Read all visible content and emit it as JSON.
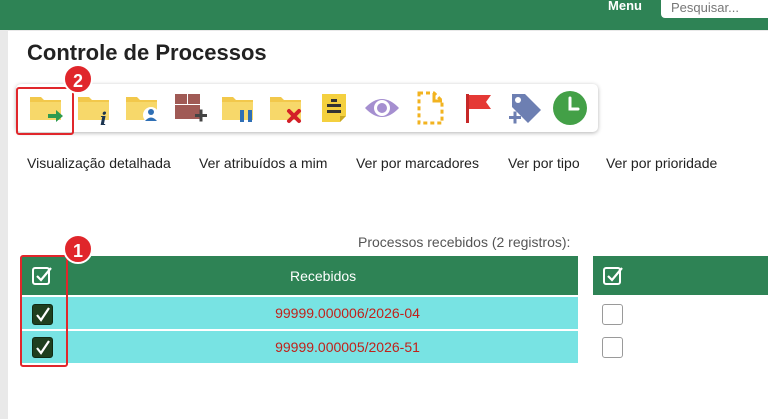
{
  "header": {
    "menu_label": "Menu",
    "search_placeholder": "Pesquisar..."
  },
  "page": {
    "title": "Controle de Processos"
  },
  "toolbar": {
    "icons": [
      "iniciar-processo-icon",
      "retorno-programado-info-icon",
      "atribuir-processo-icon",
      "incluir-em-bloco-icon",
      "sobrestar-processo-icon",
      "concluir-processo-icon",
      "anotacoes-icon",
      "acompanhamento-especial-icon",
      "documento-icon",
      "marcador-icon",
      "adicionar-tipo-icon",
      "prazo-icon"
    ]
  },
  "view_links": [
    "Visualização detalhada",
    "Ver atribuídos a mim",
    "Ver por marcadores",
    "Ver por tipo",
    "Ver por prioridade"
  ],
  "table": {
    "caption": "Processos recebidos (2 registros):",
    "header_label": "Recebidos",
    "rows": [
      {
        "process": "99999.000006/2026-04",
        "checked": true
      },
      {
        "process": "99999.000005/2026-51",
        "checked": true
      }
    ]
  },
  "annotations": {
    "badge_1": "1",
    "badge_2": "2",
    "color": "#e0262b"
  },
  "colors": {
    "brand_green": "#2e8355",
    "row_highlight": "#78e3e3",
    "link_red": "#c0221b"
  }
}
